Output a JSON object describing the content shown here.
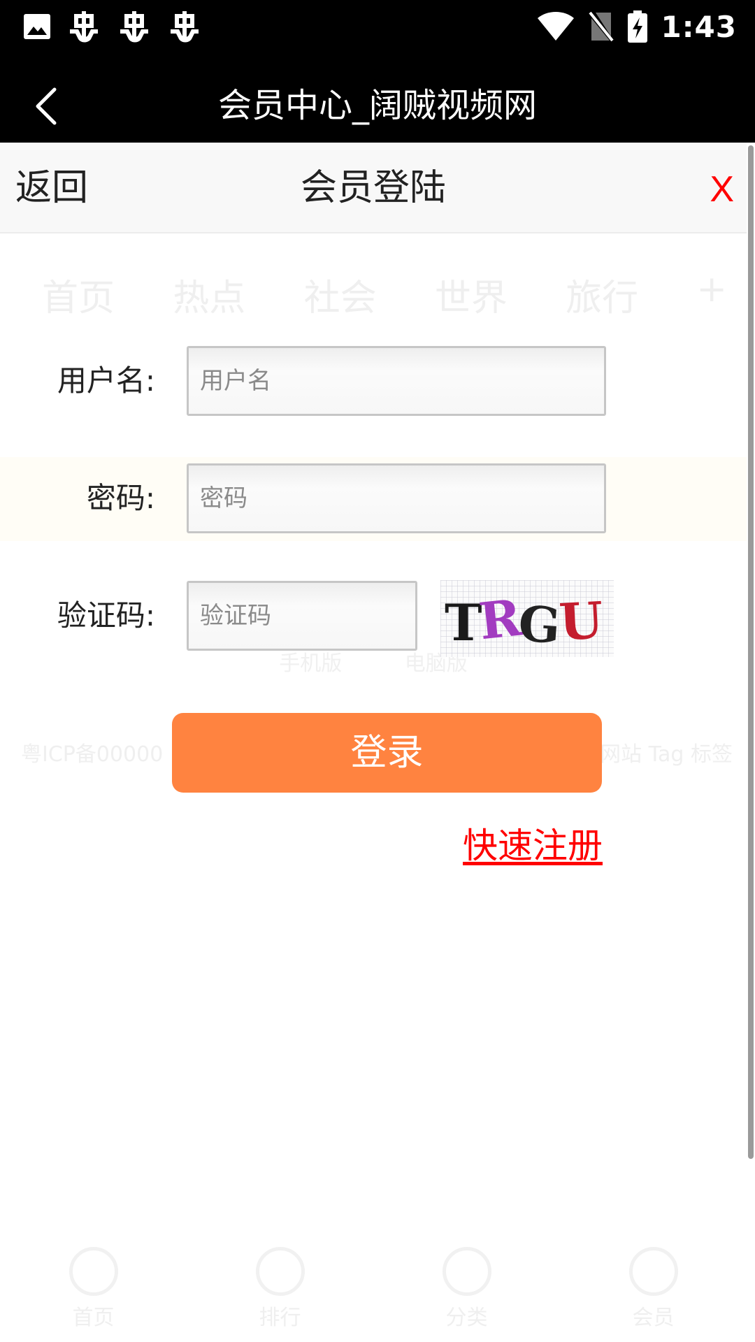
{
  "status_bar": {
    "time": "1:43",
    "icons": [
      "gallery-icon",
      "bug-icon",
      "bug-icon",
      "bug-icon",
      "wifi-icon",
      "no-sim-icon",
      "battery-charging-icon"
    ]
  },
  "app_bar": {
    "title": "会员中心_阔贼视频网",
    "back_icon": "chevron-left-icon"
  },
  "login_header": {
    "back_label": "返回",
    "title": "会员登陆",
    "close_label": "X"
  },
  "form": {
    "username_label": "用户名:",
    "username_placeholder": "用户名",
    "password_label": "密码:",
    "password_placeholder": "密码",
    "captcha_label": "验证码:",
    "captcha_placeholder": "验证码",
    "captcha_text": [
      "T",
      "R",
      "G",
      "U"
    ],
    "login_button": "登录",
    "register_link": "快速注册"
  },
  "background_page": {
    "nav": [
      "首页",
      "热点",
      "社会",
      "世界",
      "旅行",
      "+"
    ],
    "mini_links": [
      "手机版",
      "电脑版"
    ],
    "footer_left": "粤ICP备00000",
    "footer_right": "网站 Tag 标签",
    "tabs": [
      "首页",
      "排行",
      "分类",
      "会员"
    ]
  },
  "colors": {
    "accent": "#ff8340",
    "danger": "#ff0000",
    "bar": "#000000"
  }
}
